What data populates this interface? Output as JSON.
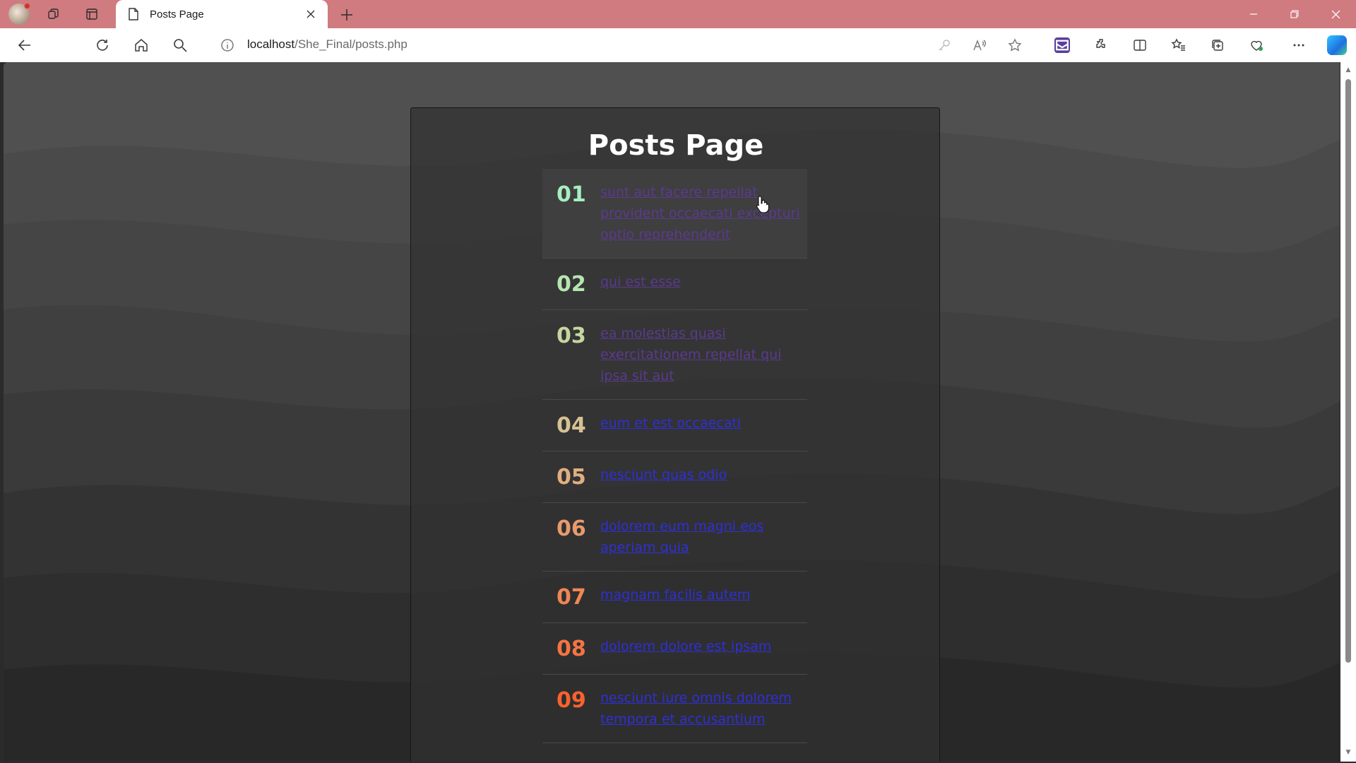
{
  "browser": {
    "tab_title": "Posts Page",
    "url_host": "localhost",
    "url_path": "/She_Final/posts.php"
  },
  "page": {
    "title": "Posts Page"
  },
  "posts": [
    {
      "num": "01",
      "title": "sunt aut facere repellat provident occaecati excepturi optio reprehenderit",
      "num_color": "#a8eec0",
      "link_color": "#5a3a8e",
      "hovered": true
    },
    {
      "num": "02",
      "title": "qui est esse",
      "num_color": "#b6e6b0",
      "link_color": "#5a3a8e",
      "hovered": false
    },
    {
      "num": "03",
      "title": "ea molestias quasi exercitationem repellat qui ipsa sit aut",
      "num_color": "#c6d6a0",
      "link_color": "#5a3a8e",
      "hovered": false
    },
    {
      "num": "04",
      "title": "eum et est occaecati",
      "num_color": "#d6c292",
      "link_color": "#2f2fd6",
      "hovered": false
    },
    {
      "num": "05",
      "title": "nesciunt quas odio",
      "num_color": "#e0ae80",
      "link_color": "#2f2fd6",
      "hovered": false
    },
    {
      "num": "06",
      "title": "dolorem eum magni eos aperiam quia",
      "num_color": "#e89a6c",
      "link_color": "#2f2fd6",
      "hovered": false
    },
    {
      "num": "07",
      "title": "magnam facilis autem",
      "num_color": "#ef8656",
      "link_color": "#2f2fd6",
      "hovered": false
    },
    {
      "num": "08",
      "title": "dolorem dolore est ipsam",
      "num_color": "#f47442",
      "link_color": "#2f2fd6",
      "hovered": false
    },
    {
      "num": "09",
      "title": "nesciunt iure omnis dolorem tempora et accusantium",
      "num_color": "#f8622e",
      "link_color": "#2f2fd6",
      "hovered": false
    }
  ]
}
